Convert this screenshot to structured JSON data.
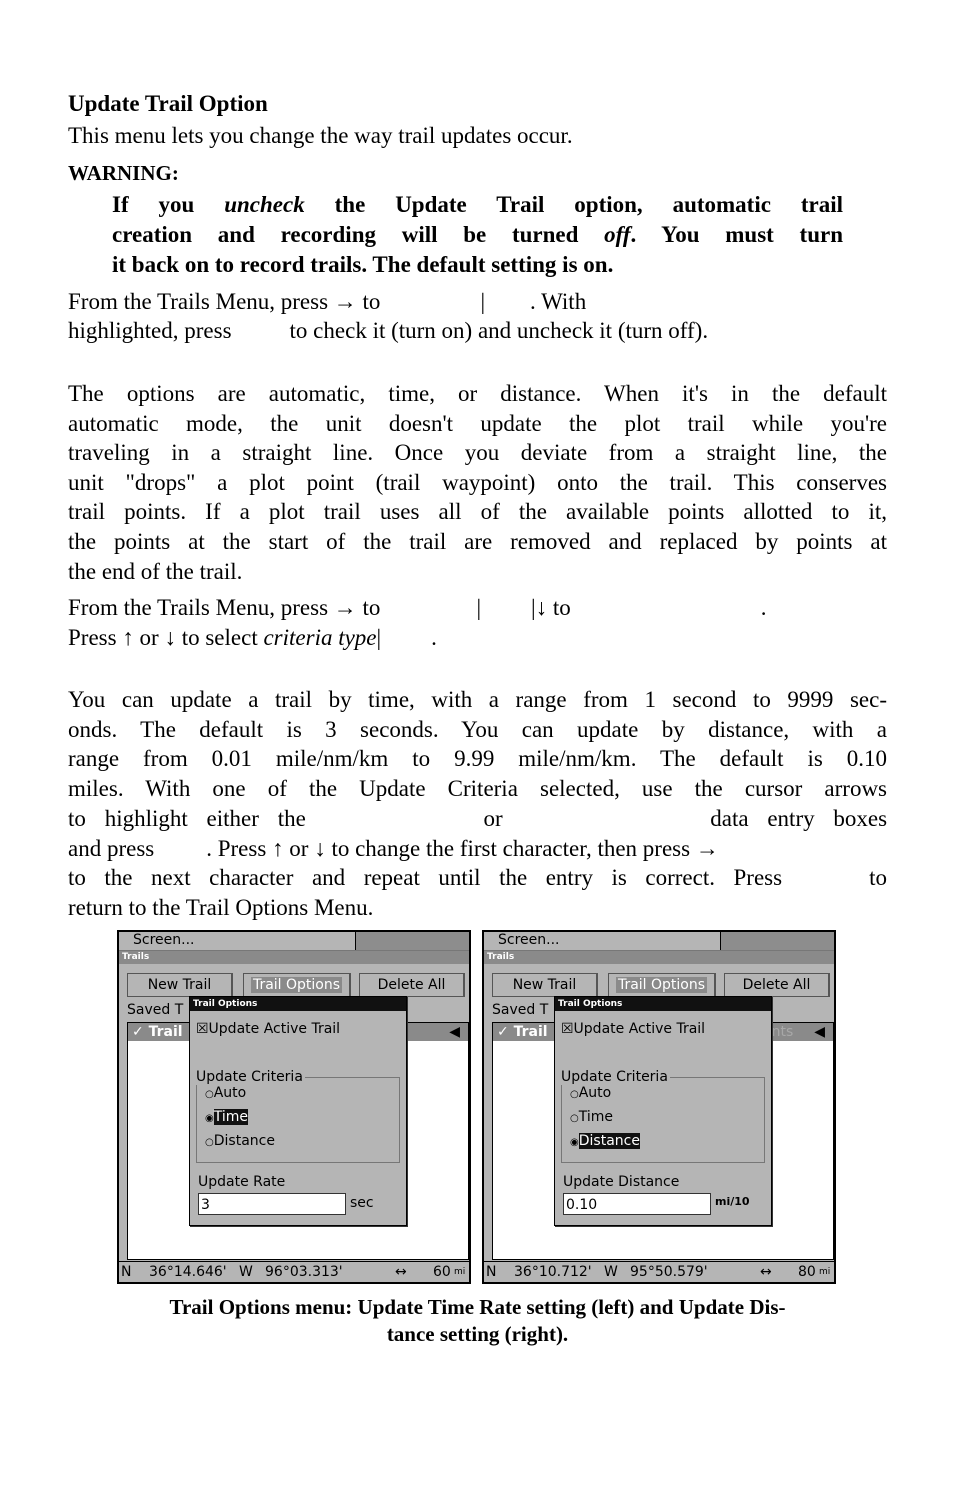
{
  "heading": "Update Trail Option",
  "intro": "This menu lets you change the way trail updates occur.",
  "warning_label": "WARNING:",
  "warning_lines": [
    [
      "If you ",
      "uncheck",
      " the Update Trail option, automatic trail"
    ],
    [
      "creation and recording will be turned ",
      "off",
      ". You must turn"
    ],
    [
      "it back on to record trails. The default setting is on."
    ]
  ],
  "para1": {
    "l1a": "From the Trails Menu, press → to",
    "l1b": "|",
    "l1c": ". With",
    "l2a": "highlighted, press",
    "l2b": "to check it (turn on) and uncheck it (turn off)."
  },
  "para2": [
    "The options are automatic, time, or distance. When it's in the default",
    "automatic mode, the unit doesn't update the plot trail while you're",
    "traveling in a straight line. Once you deviate from a straight line, the",
    "unit \"drops\" a plot point (trail waypoint) onto the trail. This conserves",
    "trail points. If a plot trail uses all of the available points allotted to it,",
    "the points at the start of the trail are removed and replaced by points at",
    "the end of the trail."
  ],
  "para3": {
    "l1a": "From the Trails Menu, press → to",
    "l1b": "|",
    "l1c": "|↓ to",
    "l1d": ".",
    "l2a": "Press ↑ or ↓ to select ",
    "l2b": "criteria type",
    "l2c": "|",
    "l2d": "."
  },
  "para4": [
    "You can update a trail by time, with a range from 1 second to 9999 sec-",
    "onds. The default is 3 seconds. You can update by distance, with a",
    "range from 0.01 mile/nm/km to 9.99 mile/nm/km. The default is 0.10",
    "miles. With one of the Update Criteria selected, use the cursor arrows"
  ],
  "para4b": {
    "a": "to highlight either the",
    "b": "or",
    "c": "data entry boxes",
    "d": "and press",
    "e": ". Press ↑ or ↓ to change the first character, then press →",
    "f": "to the next character and repeat until the entry is correct. Press",
    "g": "to",
    "h": "return to the Trail Options Menu."
  },
  "screens": [
    {
      "top": "Screen...",
      "bar": "Trails",
      "buttons": [
        "New Trail",
        "Trail Options",
        "Delete All"
      ],
      "saved": "Saved T",
      "row": "✓ Trail",
      "ghost": "",
      "dialog_title": "Trail Options",
      "check": "☒Update Active Trail",
      "group": "Update Criteria",
      "options": [
        "Auto",
        "Time",
        "Distance"
      ],
      "selected": 1,
      "field_label": "Update Rate",
      "field_value": "3",
      "unit": "sec",
      "lat": "36°14.646'",
      "lon": "96°03.313'",
      "ns": "N",
      "ew": "W",
      "scale": "60",
      "scale_unit": "mi"
    },
    {
      "top": "Screen...",
      "bar": "Trails",
      "buttons": [
        "New Trail",
        "Trail Options",
        "Delete All"
      ],
      "saved": "Saved T",
      "row": "✓ Trail",
      "ghost": "16 Points",
      "dialog_title": "Trail Options",
      "check": "☒Update Active Trail",
      "group": "Update Criteria",
      "options": [
        "Auto",
        "Time",
        "Distance"
      ],
      "selected": 2,
      "field_label": "Update Distance",
      "field_value": "0.10",
      "unit": "mi/10",
      "lat": "36°10.712'",
      "lon": "95°50.579'",
      "ns": "N",
      "ew": "W",
      "scale": "80",
      "scale_unit": "mi"
    }
  ],
  "caption": [
    "Trail Options menu: Update Time Rate setting (left) and Update Dis-",
    "tance setting (right)."
  ]
}
